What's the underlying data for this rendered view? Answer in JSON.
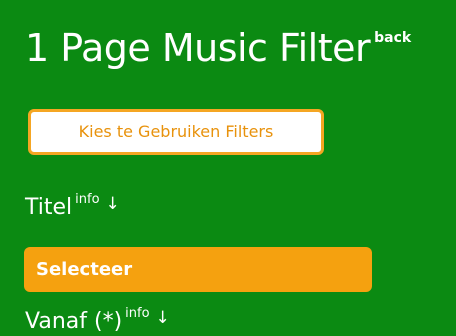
{
  "header": {
    "title": "1 Page Music Filter",
    "back_label": "back"
  },
  "filters_button": {
    "label": "Kies te Gebruiken Filters"
  },
  "sections": [
    {
      "label": "Titel",
      "info_label": "info",
      "arrow": "↓",
      "select_label": "Selecteer"
    },
    {
      "label": "Vanaf (*)",
      "info_label": "info",
      "arrow": "↓"
    }
  ],
  "colors": {
    "background": "#0b8a12",
    "accent": "#f5a10f",
    "button_border": "#f5a623",
    "text": "#ffffff"
  }
}
